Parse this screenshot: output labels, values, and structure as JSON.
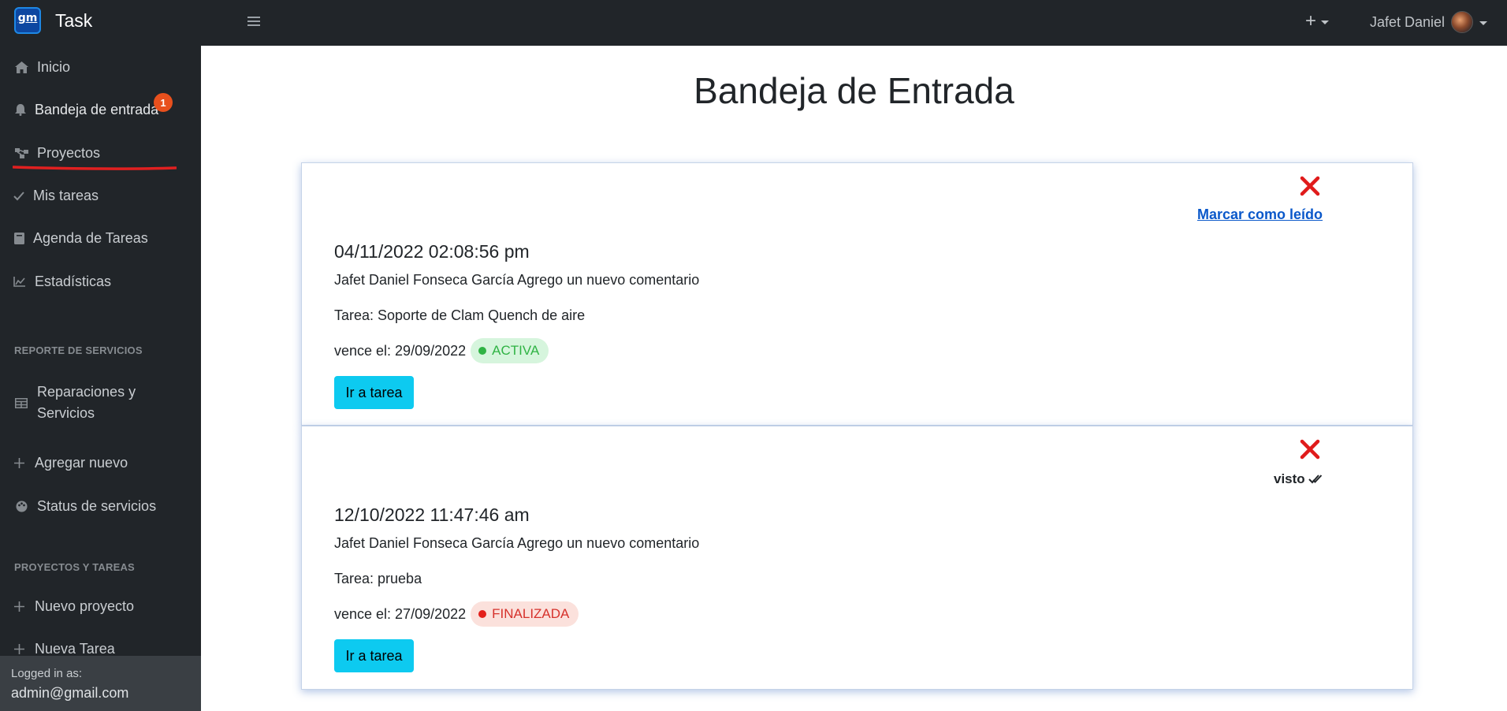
{
  "app": {
    "brand_logo_text": "gm",
    "brand_name": "Task"
  },
  "topbar": {
    "menu_icon": "hamburger-icon",
    "add_label": "+",
    "user_name": "Jafet Daniel"
  },
  "sidebar": {
    "items": [
      {
        "label": "Inicio",
        "icon": "home-icon"
      },
      {
        "label": "Bandeja de entrada",
        "icon": "bell-icon",
        "badge": "1",
        "active": true
      },
      {
        "label": "Proyectos",
        "icon": "sitemap-icon"
      },
      {
        "label": "Mis tareas",
        "icon": "check-icon"
      },
      {
        "label": "Agenda de Tareas",
        "icon": "book-icon"
      },
      {
        "label": "Estadísticas",
        "icon": "chart-icon"
      }
    ],
    "section_servicios": "REPORTE DE SERVICIOS",
    "servicios_items": [
      {
        "label_line1": "Reparaciones y",
        "label_line2": "Servicios",
        "icon": "table-icon"
      },
      {
        "label": "Agregar nuevo",
        "icon": "plus-icon"
      },
      {
        "label": "Status de servicios",
        "icon": "palette-icon"
      }
    ],
    "section_proyectos": "PROYECTOS Y TAREAS",
    "proyectos_items": [
      {
        "label": "Nuevo proyecto",
        "icon": "plus-icon"
      },
      {
        "label": "Nueva Tarea",
        "icon": "plus-icon"
      }
    ],
    "footer": {
      "logged_label": "Logged in as:",
      "email": "admin@gmail.com"
    }
  },
  "main": {
    "title": "Bandeja de Entrada",
    "notifications": [
      {
        "datetime": "04/11/2022 02:08:56 pm",
        "message": "Jafet Daniel Fonseca García Agrego un nuevo comentario",
        "task": "Tarea: Soporte de Clam Quench de aire",
        "due": "vence el: 29/09/2022",
        "status": "ACTIVA",
        "status_color": "#2fb344",
        "status_bg": "#d6f5dd",
        "action_label": "Marcar como leído",
        "button_label": "Ir a tarea"
      },
      {
        "datetime": "12/10/2022 11:47:46 am",
        "message": "Jafet Daniel Fonseca García Agrego un nuevo comentario",
        "task": "Tarea: prueba",
        "due": "vence el: 27/09/2022",
        "status": "FINALIZADA",
        "status_color": "#d6312b",
        "status_bg": "#fbe1dc",
        "seen_label": "visto",
        "button_label": "Ir a tarea"
      }
    ]
  },
  "colors": {
    "accent_button": "#0dcaf0",
    "close_x": "#e01b1b",
    "link": "#0a58ca",
    "badge": "#e8501d"
  }
}
